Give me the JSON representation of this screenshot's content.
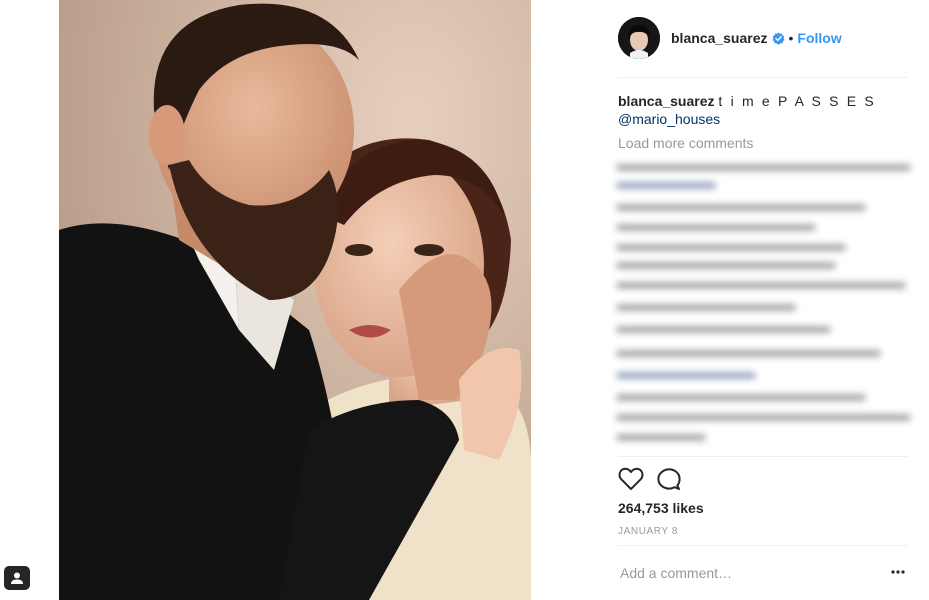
{
  "post": {
    "image_alt": "Photo of a bearded man in a dark suit embracing a woman with dark hair",
    "author": {
      "username": "blanca_suarez",
      "verified": true,
      "verified_icon": "verified-badge-icon",
      "follow_separator": "•",
      "follow_label": "Follow"
    },
    "caption": {
      "username": "blanca_suarez",
      "text": "t i m e P A S S E S",
      "mention": "@mario_houses"
    },
    "load_more_label": "Load more comments",
    "actions": {
      "like_icon": "heart-icon",
      "comment_icon": "comment-icon"
    },
    "likes": "264,753 likes",
    "date": "JANUARY 8",
    "comment_box": {
      "placeholder": "Add a comment…",
      "more_icon": "more-options-icon"
    }
  },
  "colors": {
    "accent": "#3897f0",
    "text": "#262626",
    "muted": "#999999",
    "mention": "#003569",
    "divider": "#efefef"
  }
}
